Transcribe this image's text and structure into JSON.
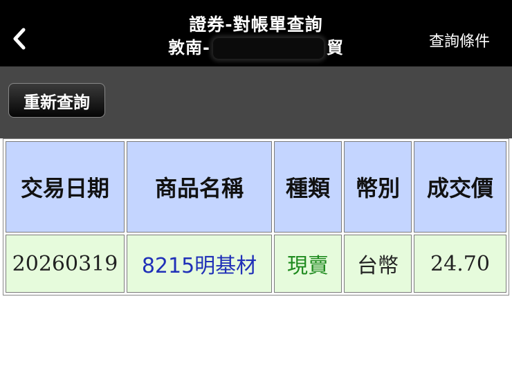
{
  "header": {
    "title_line1": "證券-對帳單查詢",
    "title_line2_prefix": "敦南-",
    "title_line2_suffix": "貿",
    "query_conditions_label": "查詢條件"
  },
  "toolbar": {
    "refresh_label": "重新查詢"
  },
  "table": {
    "columns": [
      "交易日期",
      "商品名稱",
      "種類",
      "幣別",
      "成交價"
    ],
    "rows": [
      {
        "date": "20260319",
        "product": "8215明基材",
        "type": "現賣",
        "currency": "台幣",
        "price": "24.70"
      }
    ]
  },
  "colors": {
    "header_bg": "#000000",
    "toolbar_bg": "#474747",
    "column_header_bg": "#c4d5ff",
    "row_bg": "#e6fbdc",
    "product_text": "#2030b8",
    "type_text": "#1e8a1e"
  }
}
